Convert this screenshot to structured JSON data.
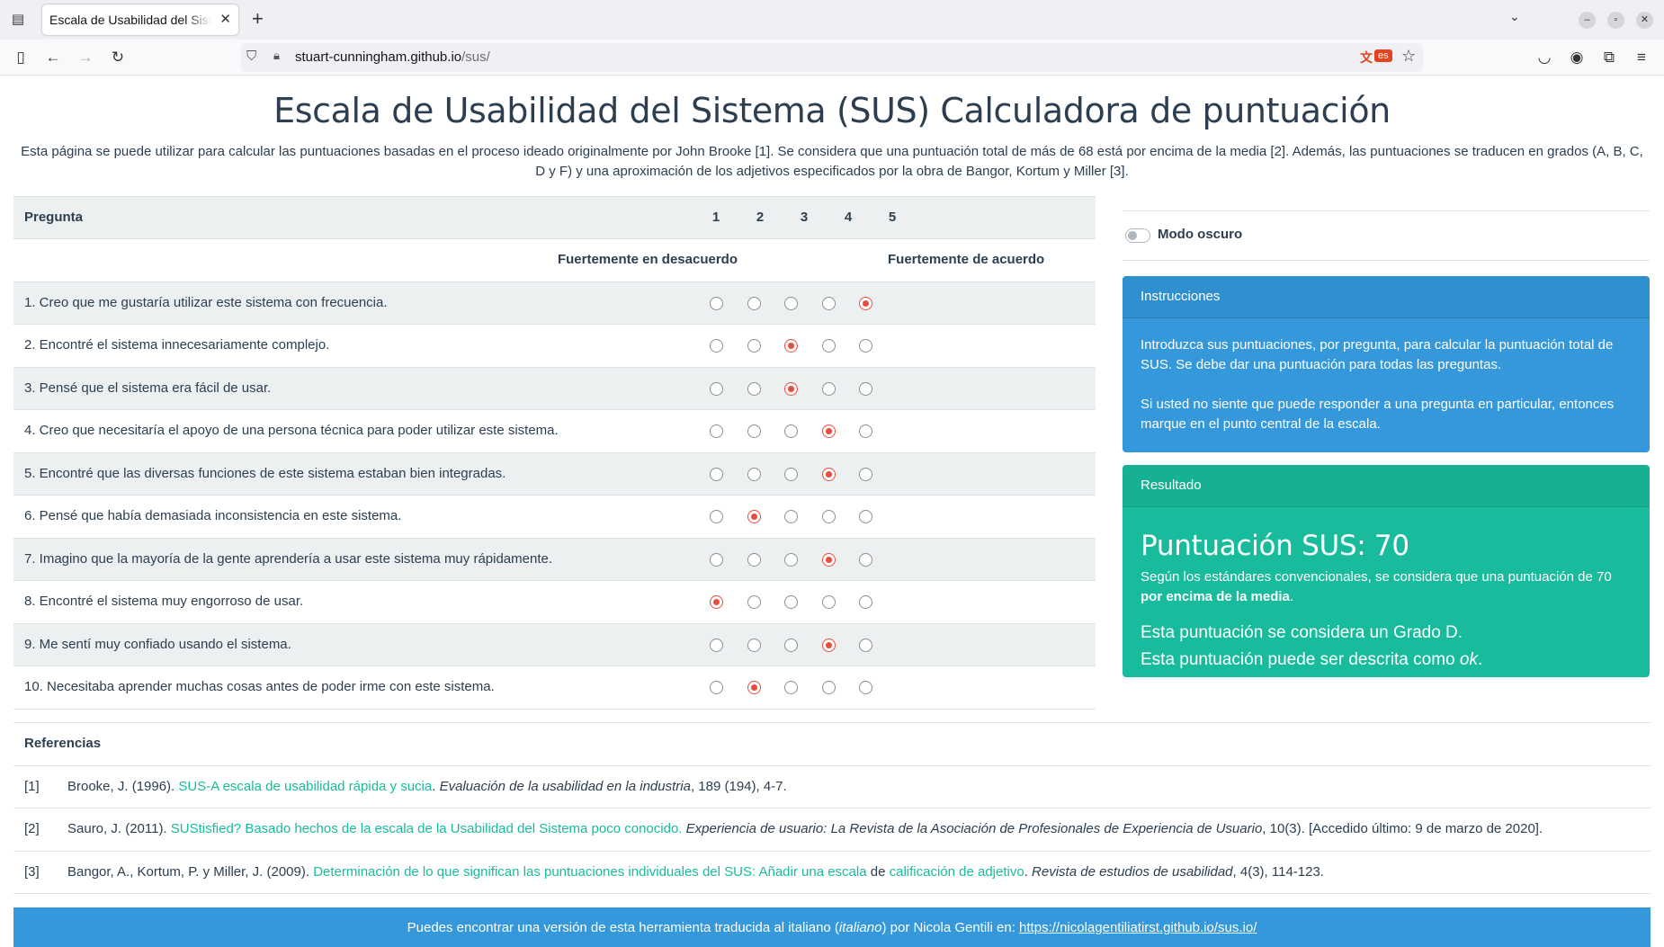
{
  "browser": {
    "tab_title": "Escala de Usabilidad del Sistema (SUS) Calculadora de puntuación",
    "url_host": "stuart-cunningham.github.io",
    "url_path": "/sus/",
    "translate_lang": "es"
  },
  "page": {
    "title": "Escala de Usabilidad del Sistema (SUS) Calculadora de puntuación",
    "intro": "Esta página se puede utilizar para calcular las puntuaciones basadas en el proceso ideado originalmente por John Brooke [1]. Se considera que una puntuación total de más de 68 está por encima de la media [2]. Además, las puntuaciones se traducen en grados (A, B, C, D y F) y una aproximación de los adjetivos especificados por la obra de Bangor, Kortum y Miller [3]."
  },
  "table": {
    "question_header": "Pregunta",
    "columns": [
      "1",
      "2",
      "3",
      "4",
      "5"
    ],
    "scale_left": "Fuertemente en desacuerdo",
    "scale_right": "Fuertemente de acuerdo",
    "questions": [
      {
        "text": "1. Creo que me gustaría utilizar este sistema con frecuencia.",
        "answer": 5
      },
      {
        "text": "2. Encontré el sistema innecesariamente complejo.",
        "answer": 3
      },
      {
        "text": "3. Pensé que el sistema era fácil de usar.",
        "answer": 3
      },
      {
        "text": "4. Creo que necesitaría el apoyo de una persona técnica para poder utilizar este sistema.",
        "answer": 4
      },
      {
        "text": "5. Encontré que las diversas funciones de este sistema estaban bien integradas.",
        "answer": 4
      },
      {
        "text": "6. Pensé que había demasiada inconsistencia en este sistema.",
        "answer": 2
      },
      {
        "text": "7. Imagino que la mayoría de la gente aprendería a usar este sistema muy rápidamente.",
        "answer": 4
      },
      {
        "text": "8. Encontré el sistema muy engorroso de usar.",
        "answer": 1
      },
      {
        "text": "9. Me sentí muy confiado usando el sistema.",
        "answer": 4
      },
      {
        "text": "10. Necesitaba aprender muchas cosas antes de poder irme con este sistema.",
        "answer": 2
      }
    ]
  },
  "dark_mode": {
    "label": "Modo oscuro",
    "enabled": false
  },
  "instructions": {
    "header": "Instrucciones",
    "p1": "Introduzca sus puntuaciones, por pregunta, para calcular la puntuación total de SUS. Se debe dar una puntuación para todas las preguntas.",
    "p2": "Si usted no siente que puede responder a una pregunta en particular, entonces marque en el punto central de la escala."
  },
  "result": {
    "header": "Resultado",
    "score_label": "Puntuación SUS: 70",
    "desc_start": "Según los estándares convencionales, se considera que una puntuación de 70 ",
    "desc_bold": "por encima de la media",
    "desc_end": ".",
    "grade_line": "Esta puntuación se considera un Grado D.",
    "adjective_start": "Esta puntuación puede ser descrita como ",
    "adjective": "ok",
    "adjective_end": "."
  },
  "references": {
    "title": "Referencias",
    "items": [
      {
        "num": "[1]",
        "pre": "Brooke, J. (1996). ",
        "link": "SUS-A escala de usabilidad rápida y sucia",
        "mid": ". ",
        "ital": "Evaluación de la usabilidad en la industria",
        "post": ", 189 (194), 4-7."
      },
      {
        "num": "[2]",
        "pre": "Sauro, J. (2011). ",
        "link": "SUStisfied? Basado hechos de la escala de la Usabilidad del Sistema poco conocido.",
        "mid": " ",
        "ital": "Experiencia de usuario: La Revista de la Asociación de Profesionales de Experiencia de Usuario",
        "post": ", 10(3). [Accedido último: 9 de marzo de 2020]."
      },
      {
        "num": "[3]",
        "pre": "Bangor, A., Kortum, P. y Miller, J. (2009). ",
        "link": "Determinación de lo que significan las puntuaciones individuales del SUS: Añadir una escala",
        "mid": " de ",
        "link2": "calificación de adjetivo",
        "mid2": ". ",
        "ital": "Revista de estudios de usabilidad",
        "post": ", 4(3), 114-123."
      }
    ]
  },
  "footer": {
    "text_start": "Puedes encontrar una versión de esta herramienta traducida al italiano (",
    "text_ital": "italiano",
    "text_mid": ") por Nicola Gentili en: ",
    "link": "https://nicolagentiliatirst.github.io/sus.io/"
  },
  "colors": {
    "accent_blue": "#3498db",
    "accent_green": "#18bc9c",
    "radio_selected": "#e74c3c",
    "text": "#2c3e50"
  }
}
